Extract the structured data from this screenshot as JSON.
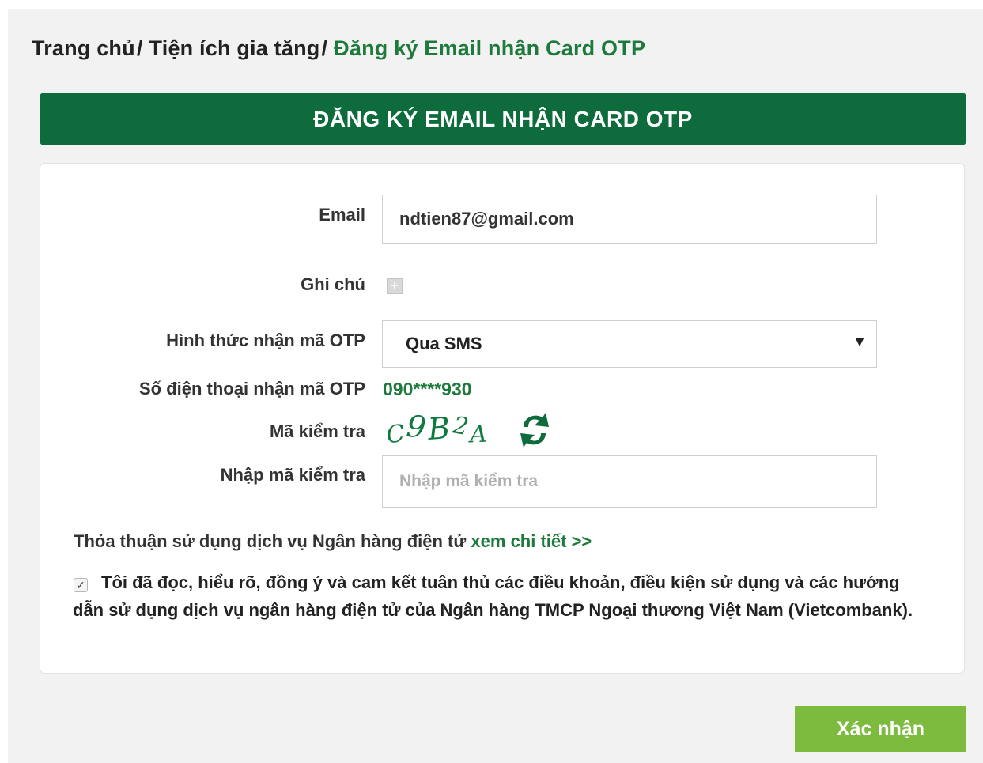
{
  "breadcrumb": {
    "items": [
      "Trang chủ",
      "Tiện ích gia tăng"
    ],
    "separator": "/",
    "current": "Đăng ký Email nhận Card OTP"
  },
  "header": {
    "title": "ĐĂNG KÝ EMAIL NHẬN CARD OTP"
  },
  "form": {
    "email": {
      "label": "Email",
      "value": "ndtien87@gmail.com"
    },
    "note": {
      "label": "Ghi chú",
      "icon": "plus-icon"
    },
    "otp_method": {
      "label": "Hình thức nhận mã OTP",
      "selected": "Qua SMS",
      "arrow": "▼"
    },
    "otp_phone": {
      "label": "Số điện thoại nhận mã OTP",
      "value": "090****930"
    },
    "captcha": {
      "label": "Mã kiểm tra",
      "code": "C9B2A",
      "icon": "refresh-icon"
    },
    "captcha_input": {
      "label": "Nhập mã kiểm tra",
      "placeholder": "Nhập mã kiểm tra"
    }
  },
  "agreement": {
    "text": "Thỏa thuận sử dụng dịch vụ Ngân hàng điện tử",
    "link": "xem chi tiết >>"
  },
  "terms": {
    "checked": true,
    "text": "Tôi đã đọc, hiểu rõ, đồng ý và cam kết tuân thủ các điều khoản, điều kiện sử dụng và các hướng dẫn sử dụng dịch vụ ngân hàng điện tử của Ngân hàng TMCP Ngoại thương Việt Nam (Vietcombank)."
  },
  "actions": {
    "confirm_label": "Xác nhận"
  },
  "colors": {
    "brand_dark": "#0d6b3c",
    "brand_text": "#1e7a3c",
    "button": "#7dbb3f"
  }
}
